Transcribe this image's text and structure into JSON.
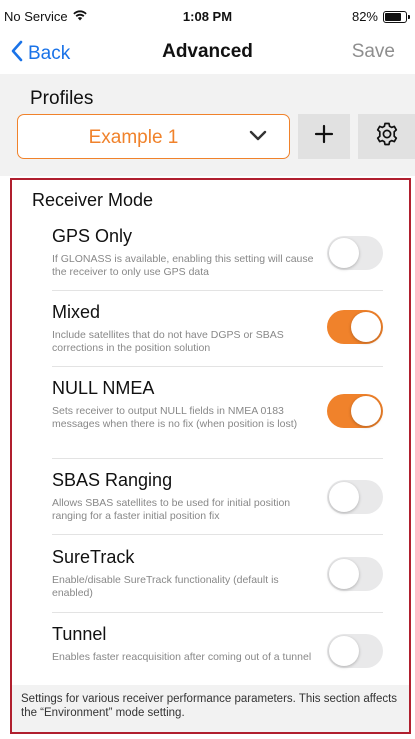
{
  "status_bar": {
    "carrier": "No Service",
    "wifi_icon": "wifi-icon",
    "time": "1:08 PM",
    "battery_percent": "82%",
    "battery_level": 0.82
  },
  "nav": {
    "back_label": "Back",
    "title": "Advanced",
    "save_label": "Save"
  },
  "profiles": {
    "label": "Profiles",
    "selected": "Example 1",
    "add_label": "+"
  },
  "receiver_mode": {
    "title": "Receiver Mode",
    "items": [
      {
        "title": "GPS Only",
        "description": "If GLONASS is available, enabling this setting will cause the receiver to only use GPS data",
        "enabled": false
      },
      {
        "title": "Mixed",
        "description": "Include satellites that do not have DGPS or SBAS corrections in the position solution",
        "enabled": true
      },
      {
        "title": "NULL NMEA",
        "description": "Sets receiver to output NULL fields in NMEA 0183 messages when there is no fix (when position is lost)",
        "enabled": true
      },
      {
        "title": "SBAS Ranging",
        "description": "Allows SBAS satellites to be used for initial position ranging for a faster initial position fix",
        "enabled": false
      },
      {
        "title": "SureTrack",
        "description": "Enable/disable SureTrack functionality (default is enabled)",
        "enabled": false
      },
      {
        "title": "Tunnel",
        "description": "Enables faster reacquisition after coming out of a tunnel",
        "enabled": false
      }
    ],
    "footer": "Settings for various receiver performance parameters.  This section affects the “Environment” mode setting."
  },
  "colors": {
    "accent": "#f0822b",
    "link": "#1a73e8",
    "highlight_border": "#b01f2e"
  }
}
